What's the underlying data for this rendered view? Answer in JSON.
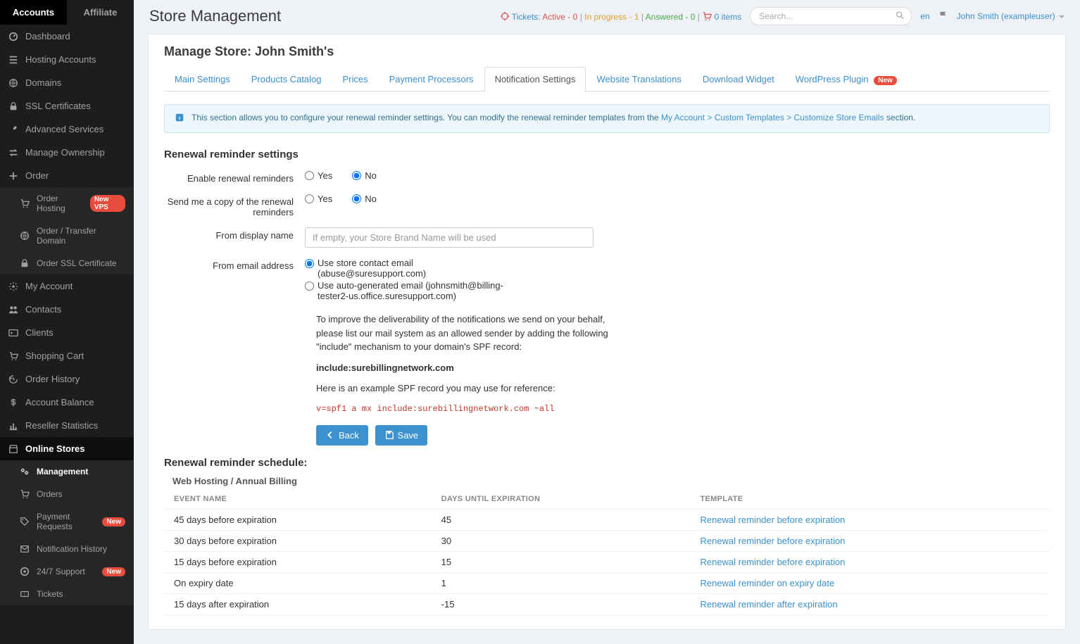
{
  "topTabs": {
    "accounts": "Accounts",
    "affiliate": "Affiliate"
  },
  "sidebar": {
    "items": [
      {
        "label": "Dashboard",
        "icon": "dashboard"
      },
      {
        "label": "Hosting Accounts",
        "icon": "list"
      },
      {
        "label": "Domains",
        "icon": "globe"
      },
      {
        "label": "SSL Certificates",
        "icon": "lock"
      },
      {
        "label": "Advanced Services",
        "icon": "wrench"
      },
      {
        "label": "Manage Ownership",
        "icon": "swap"
      },
      {
        "label": "Order",
        "icon": "plus"
      }
    ],
    "orderSub": [
      {
        "label": "Order Hosting",
        "icon": "cart",
        "badge": "New VPS"
      },
      {
        "label": "Order / Transfer Domain",
        "icon": "globe"
      },
      {
        "label": "Order SSL Certificate",
        "icon": "lock"
      }
    ],
    "items2": [
      {
        "label": "My Account",
        "icon": "gear"
      },
      {
        "label": "Contacts",
        "icon": "users"
      },
      {
        "label": "Clients",
        "icon": "card"
      },
      {
        "label": "Shopping Cart",
        "icon": "cart"
      },
      {
        "label": "Order History",
        "icon": "history"
      },
      {
        "label": "Account Balance",
        "icon": "dollar"
      },
      {
        "label": "Reseller Statistics",
        "icon": "chart"
      }
    ],
    "storesHead": "Online Stores",
    "storesSub": [
      {
        "label": "Management",
        "icon": "gears",
        "active": true
      },
      {
        "label": "Orders",
        "icon": "cart"
      },
      {
        "label": "Payment Requests",
        "icon": "tag",
        "badge": "New"
      },
      {
        "label": "Notification History",
        "icon": "mail"
      },
      {
        "label": "24/7 Support",
        "icon": "support",
        "badge": "New"
      },
      {
        "label": "Tickets",
        "icon": "ticket"
      }
    ]
  },
  "header": {
    "title": "Store Management",
    "ticketsLabel": "Tickets:",
    "activeLabel": "Active",
    "activeCount": "0",
    "progressLabel": "In progress",
    "progressCount": "1",
    "answeredLabel": "Answered",
    "answeredCount": "0",
    "cartItems": "0 items",
    "lang": "en",
    "user": "John Smith (exampleuser)",
    "searchPlaceholder": "Search..."
  },
  "manage": {
    "title": "Manage Store: John Smith's",
    "tabs": [
      "Main Settings",
      "Products Catalog",
      "Prices",
      "Payment Processors",
      "Notification Settings",
      "Website Translations",
      "Download Widget",
      "WordPress Plugin"
    ],
    "activeTab": 4,
    "pluginBadge": "New"
  },
  "info": {
    "textA": "This section allows you to configure your renewal reminder settings. You can modify the renewal reminder templates from the ",
    "linkText": "My Account > Custom Templates > Customize Store Emails",
    "textB": " section."
  },
  "form": {
    "heading": "Renewal reminder settings",
    "enableLabel": "Enable renewal reminders",
    "copyLabel": "Send me a copy of the renewal reminders",
    "yes": "Yes",
    "no": "No",
    "displayNameLabel": "From display name",
    "displayNamePlaceholder": "If empty, your Store Brand Name will be used",
    "fromEmailLabel": "From email address",
    "fromEmailOpt1": "Use store contact email (abuse@suresupport.com)",
    "fromEmailOpt2": "Use auto-generated email (johnsmith@billing-tester2-us.office.suresupport.com)",
    "spfPara": "To improve the deliverability of the notifications we send on your behalf, please list our mail system as an allowed sender by adding the following \"include\" mechanism to your domain's SPF record:",
    "spfInclude": "include:surebillingnetwork.com",
    "spfExampleIntro": "Here is an example SPF record you may use for reference:",
    "spfExample": "v=spf1 a mx include:surebillingnetwork.com ~all",
    "back": "Back",
    "save": "Save"
  },
  "schedule": {
    "heading": "Renewal reminder schedule:",
    "group": "Web Hosting / Annual Billing",
    "cols": [
      "EVENT NAME",
      "DAYS UNTIL EXPIRATION",
      "TEMPLATE"
    ],
    "rows": [
      {
        "event": "45 days before expiration",
        "days": "45",
        "template": "Renewal reminder before expiration"
      },
      {
        "event": "30 days before expiration",
        "days": "30",
        "template": "Renewal reminder before expiration"
      },
      {
        "event": "15 days before expiration",
        "days": "15",
        "template": "Renewal reminder before expiration"
      },
      {
        "event": "On expiry date",
        "days": "1",
        "template": "Renewal reminder on expiry date"
      },
      {
        "event": "15 days after expiration",
        "days": "-15",
        "template": "Renewal reminder after expiration"
      }
    ]
  }
}
